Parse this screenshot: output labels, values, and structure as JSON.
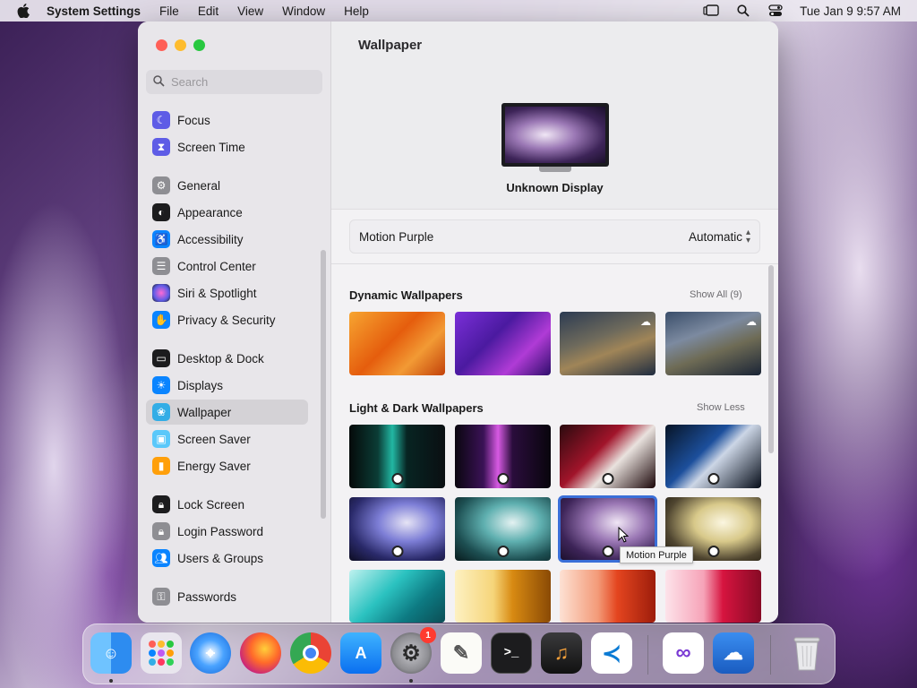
{
  "menubar": {
    "app_name": "System Settings",
    "menus": [
      "File",
      "Edit",
      "View",
      "Window",
      "Help"
    ],
    "clock": "Tue Jan 9  9:57 AM"
  },
  "sidebar": {
    "search_placeholder": "Search",
    "items": [
      {
        "label": "Focus",
        "icon": "moon-icon",
        "color": "#5e5ce6"
      },
      {
        "label": "Screen Time",
        "icon": "hourglass-icon",
        "color": "#5e5ce6"
      },
      {
        "label": "General",
        "icon": "gear-icon",
        "color": "#8e8e93"
      },
      {
        "label": "Appearance",
        "icon": "appearance-icon",
        "color": "#1c1c1e"
      },
      {
        "label": "Accessibility",
        "icon": "accessibility-icon",
        "color": "#0a84ff"
      },
      {
        "label": "Control Center",
        "icon": "control-center-icon",
        "color": "#8e8e93"
      },
      {
        "label": "Siri & Spotlight",
        "icon": "siri-icon",
        "color": "#bf5af2"
      },
      {
        "label": "Privacy & Security",
        "icon": "hand-icon",
        "color": "#0a84ff"
      },
      {
        "label": "Desktop & Dock",
        "icon": "dock-icon",
        "color": "#1c1c1e"
      },
      {
        "label": "Displays",
        "icon": "sun-icon",
        "color": "#0a84ff"
      },
      {
        "label": "Wallpaper",
        "icon": "wallpaper-icon",
        "color": "#32ade6"
      },
      {
        "label": "Screen Saver",
        "icon": "screen-saver-icon",
        "color": "#5ac8fa"
      },
      {
        "label": "Energy Saver",
        "icon": "battery-icon",
        "color": "#ff9f0a"
      },
      {
        "label": "Lock Screen",
        "icon": "lock-icon",
        "color": "#1c1c1e"
      },
      {
        "label": "Login Password",
        "icon": "lock-icon",
        "color": "#8e8e93"
      },
      {
        "label": "Users & Groups",
        "icon": "users-icon",
        "color": "#0a84ff"
      },
      {
        "label": "Passwords",
        "icon": "key-icon",
        "color": "#8e8e93"
      }
    ],
    "selected": "Wallpaper"
  },
  "main": {
    "title": "Wallpaper",
    "display_name": "Unknown Display",
    "current_wallpaper": "Motion Purple",
    "mode": "Automatic",
    "sections": [
      {
        "title": "Dynamic Wallpapers",
        "link": "Show All (9)"
      },
      {
        "title": "Light & Dark Wallpapers",
        "link": "Show Less"
      }
    ],
    "tooltip": "Motion Purple"
  },
  "dock": {
    "apps": [
      "Finder",
      "Launchpad",
      "Safari",
      "Firefox",
      "Chrome",
      "App Store",
      "System Settings",
      "TextEdit",
      "Terminal",
      "GarageBand",
      "VS Code",
      "Visual Studio",
      "Weather",
      "Trash"
    ],
    "settings_badge": "1"
  }
}
